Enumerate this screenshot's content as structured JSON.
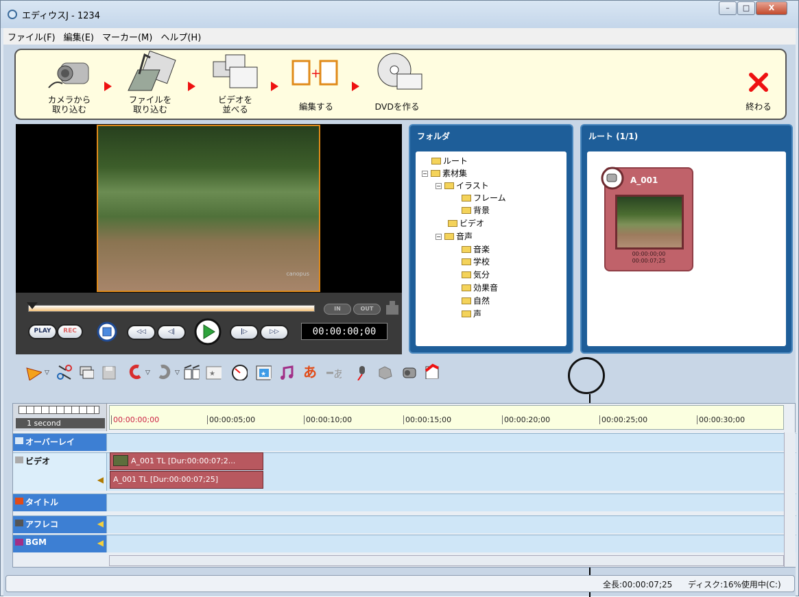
{
  "window": {
    "title": "エディウスJ - 1234",
    "minimize": "–",
    "maximize": "□",
    "close": "X"
  },
  "menu": [
    "ファイル(F)",
    "編集(E)",
    "マーカー(M)",
    "ヘルプ(H)"
  ],
  "wizard": {
    "steps": [
      {
        "label1": "カメラから",
        "label2": "取り込む",
        "icon": "camera-icon"
      },
      {
        "label1": "ファイルを",
        "label2": "取り込む",
        "icon": "folder-import-icon"
      },
      {
        "label1": "ビデオを",
        "label2": "並べる",
        "icon": "film-arrange-icon"
      },
      {
        "label1": "編集する",
        "label2": "",
        "icon": "edit-film-icon"
      },
      {
        "label1": "DVDを作る",
        "label2": "",
        "icon": "dvd-icon"
      }
    ],
    "exit_label": "終わる"
  },
  "player": {
    "brand": "canopus",
    "in_label": "IN",
    "out_label": "OUT",
    "play_label": "PLAY",
    "rec_label": "REC",
    "timecode": "00:00:00;00"
  },
  "folder_panel": {
    "title": "フォルダ",
    "tree": [
      "ルート",
      "素材集",
      "イラスト",
      "フレーム",
      "背景",
      "ビデオ",
      "音声",
      "音楽",
      "学校",
      "気分",
      "効果音",
      "自然",
      "声"
    ]
  },
  "bin_panel": {
    "title": "ルート (1/1)",
    "clip": {
      "name": "A_001",
      "tc_in": "00:00:00;00",
      "tc_out": "00:00:07;25"
    }
  },
  "timeline": {
    "scale_label": "1 second",
    "ticks": [
      "00:00:00;00",
      "00:00:05;00",
      "00:00:10;00",
      "00:00:15;00",
      "00:00:20;00",
      "00:00:25;00",
      "00:00:30;00"
    ],
    "tracks": {
      "overlay": "オーバーレイ",
      "video": "ビデオ",
      "title": "タイトル",
      "voice": "アフレコ",
      "bgm": "BGM"
    },
    "video_clip": "A_001  TL [Dur:00:00:07;2...",
    "audio_clip": "A_001  TL [Dur:00:00:07;25]"
  },
  "status": {
    "total": "全長:00:00:07;25",
    "disk": "ディスク:16%使用中(C:)"
  }
}
